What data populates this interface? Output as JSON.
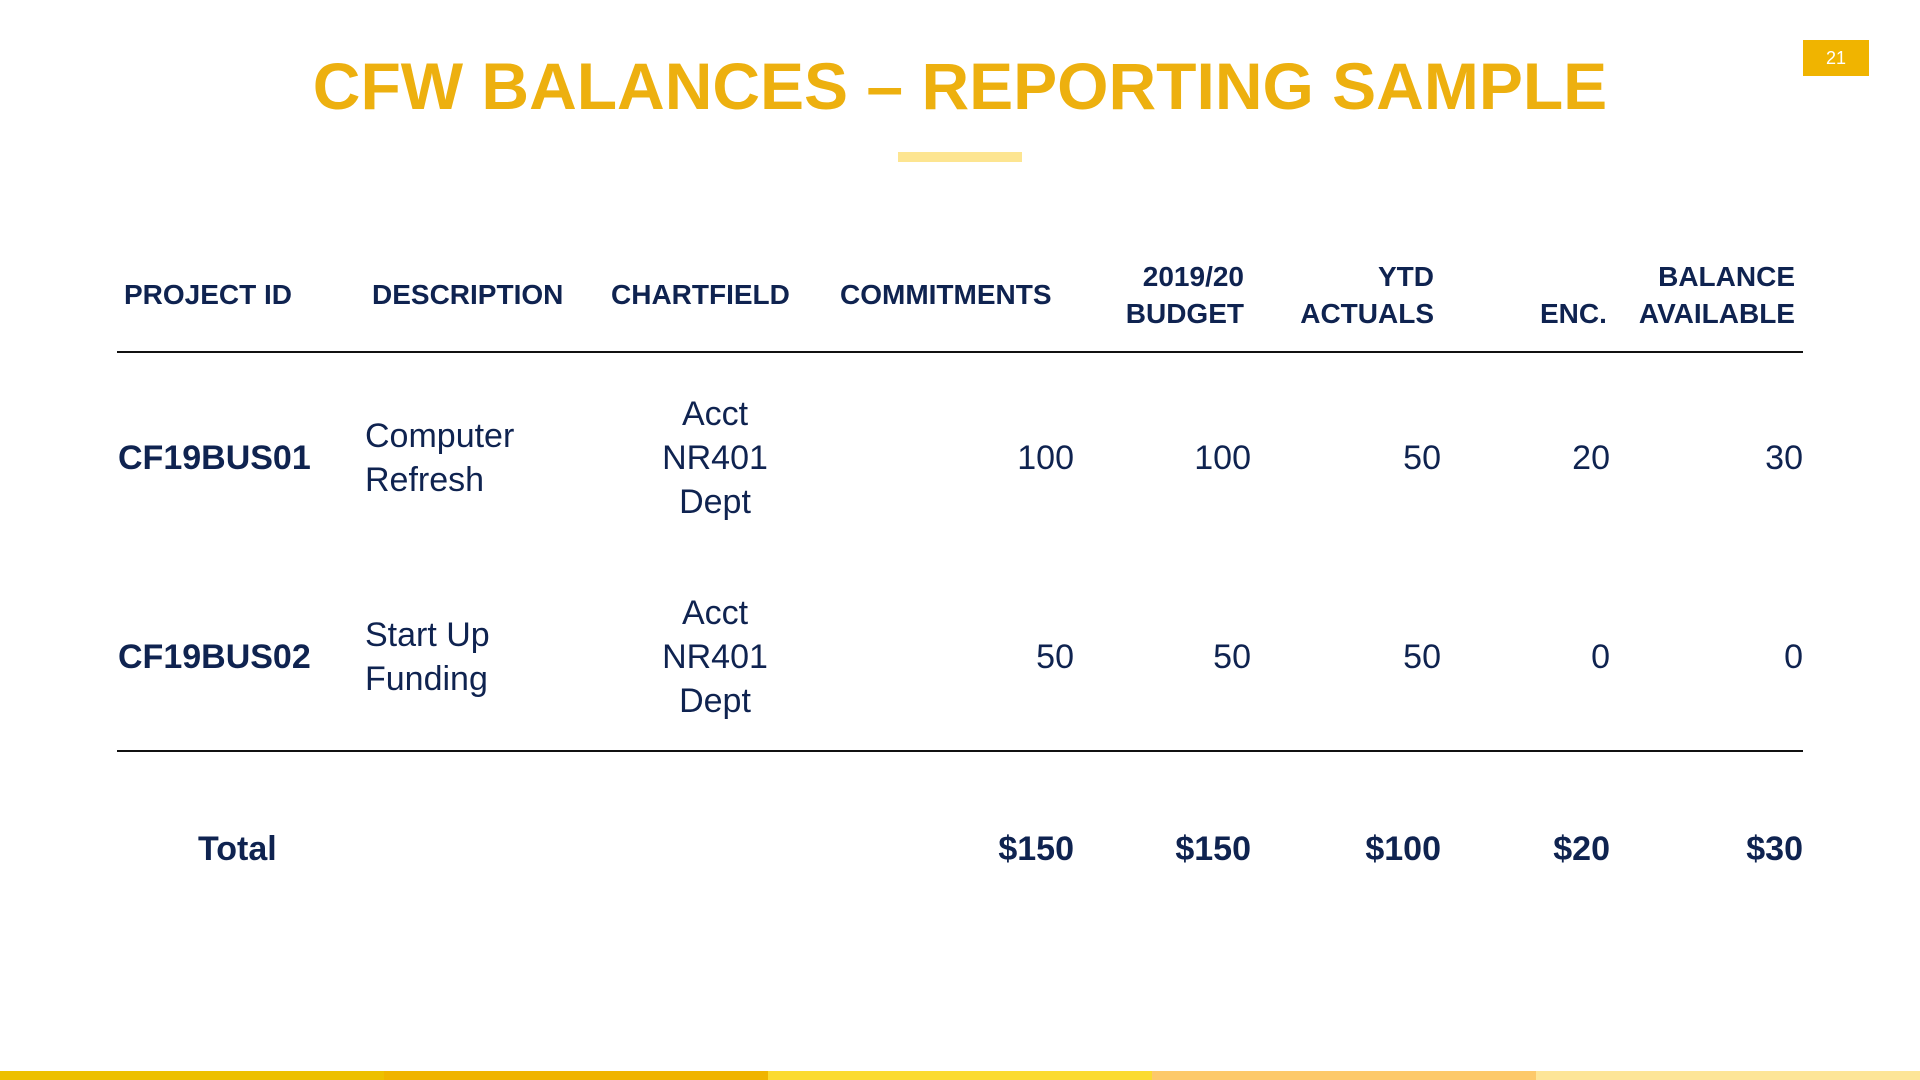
{
  "slide": {
    "title": "CFW BALANCES – REPORTING SAMPLE",
    "page_number": "21",
    "accent_color": "#EDB00F",
    "text_color": "#0f2350"
  },
  "table": {
    "headers": [
      {
        "key": "project_id",
        "line1": "",
        "line2": "PROJECT ID"
      },
      {
        "key": "description",
        "line1": "",
        "line2": "DESCRIPTION"
      },
      {
        "key": "chartfield",
        "line1": "",
        "line2": "CHARTFIELD"
      },
      {
        "key": "commitments",
        "line1": "",
        "line2": "COMMITMENTS"
      },
      {
        "key": "budget",
        "line1": "2019/20",
        "line2": "BUDGET"
      },
      {
        "key": "ytd_actuals",
        "line1": "YTD",
        "line2": "ACTUALS"
      },
      {
        "key": "enc",
        "line1": "",
        "line2": "ENC."
      },
      {
        "key": "balance_available",
        "line1": "BALANCE",
        "line2": "AVAILABLE"
      }
    ],
    "rows": [
      {
        "project_id": "CF19BUS01",
        "description": [
          "Computer",
          "Refresh"
        ],
        "chartfield": [
          "Acct",
          "NR401",
          "Dept"
        ],
        "commitments": "100",
        "budget": "100",
        "ytd_actuals": "50",
        "enc": "20",
        "balance_available": "30"
      },
      {
        "project_id": "CF19BUS02",
        "description": [
          "Start Up",
          "Funding"
        ],
        "chartfield": [
          "Acct",
          "NR401",
          "Dept"
        ],
        "commitments": "50",
        "budget": "50",
        "ytd_actuals": "50",
        "enc": "0",
        "balance_available": "0"
      }
    ],
    "total": {
      "label": "Total",
      "commitments": "$150",
      "budget": "$150",
      "ytd_actuals": "$100",
      "enc": "$20",
      "balance_available": "$30"
    }
  },
  "footer": {
    "stripe_colors": [
      "#EDC000",
      "#F0B400",
      "#FBDB30",
      "#FDC96A",
      "#FDE597"
    ]
  }
}
